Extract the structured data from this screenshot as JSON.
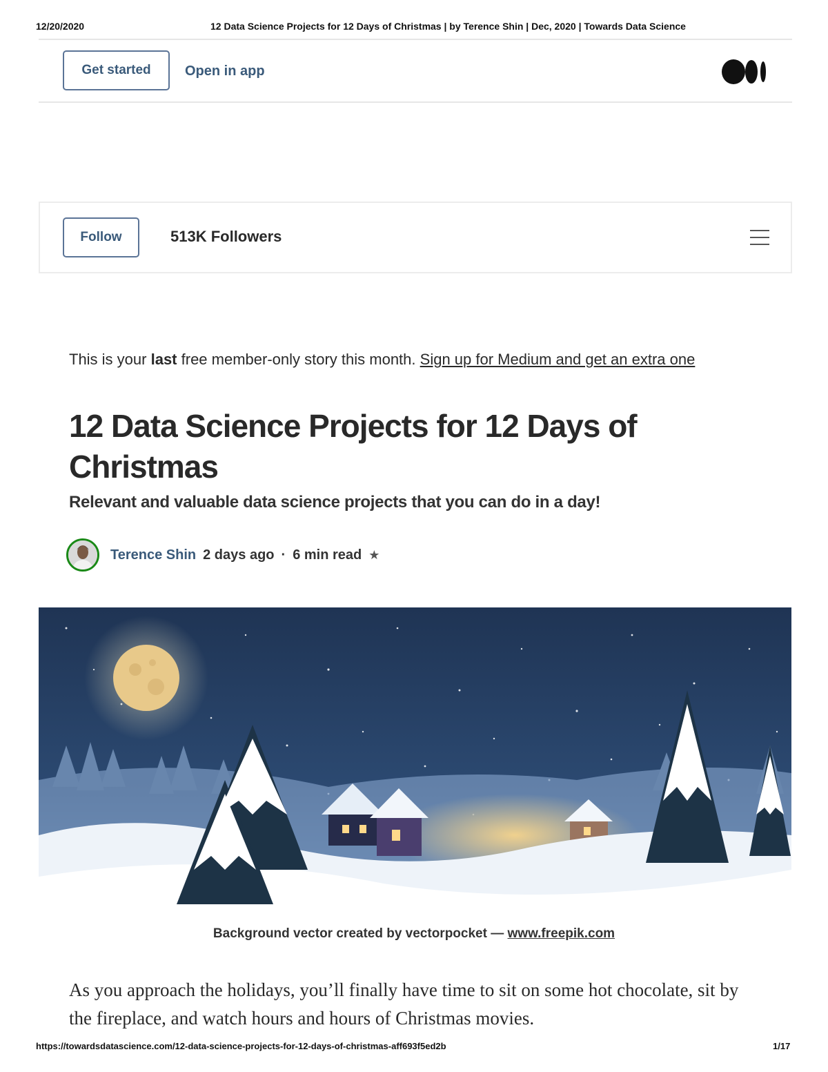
{
  "print": {
    "date": "12/20/2020",
    "title": "12 Data Science Projects for 12 Days of Christmas | by Terence Shin | Dec, 2020 | Towards Data Science",
    "url": "https://towardsdatascience.com/12-data-science-projects-for-12-days-of-christmas-aff693f5ed2b",
    "page": "1/17"
  },
  "nav": {
    "get_started_label": "Get started",
    "open_in_app_label": "Open in app",
    "logo_icon": "medium-logo-icon"
  },
  "publication": {
    "follow_label": "Follow",
    "followers": "513K Followers",
    "menu_icon": "hamburger-menu-icon"
  },
  "notice": {
    "prefix": "This is your ",
    "bold": "last",
    "middle": " free member-only story this month. ",
    "link": "Sign up for Medium and get an extra one"
  },
  "article": {
    "title": "12 Data Science Projects for 12 Days of Christmas",
    "subtitle": "Relevant and valuable data science projects that you can do in a day!",
    "author": "Terence Shin",
    "date": "2 days ago",
    "separator": "·",
    "read_time": "6 min read",
    "star_icon": "star-icon",
    "caption_text": "Background vector created by vectorpocket — ",
    "caption_link": "www.freepik.com",
    "body_first_paragraph": "As you approach the holidays, you’ll finally have time to sit on some hot chocolate, sit by the fireplace, and watch hours and hours of Christmas movies."
  },
  "colors": {
    "accent_blue": "#3a5a7a",
    "avatar_ring": "#1a8917",
    "sky_top": "#1f3454",
    "moon": "#e8c98a"
  }
}
